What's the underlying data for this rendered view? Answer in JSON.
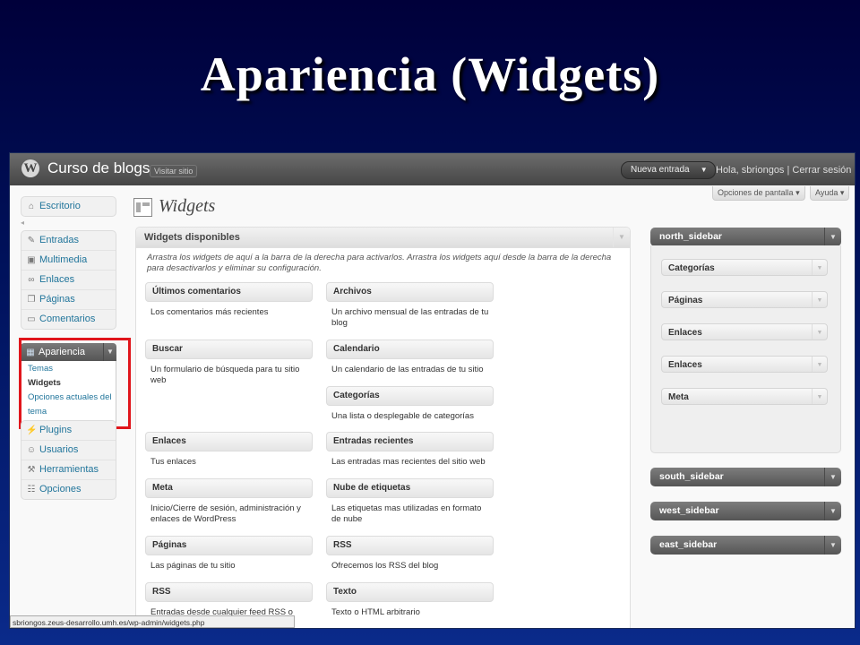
{
  "slide": {
    "title": "Apariencia (Widgets)"
  },
  "admin_bar": {
    "site_name": "Curso de blogs",
    "visit_site": "Visitar sitio",
    "new_entry": "Nueva entrada",
    "greeting": "Hola, sbriongos | Cerrar sesión"
  },
  "screen_options": {
    "options_label": "Opciones de pantalla",
    "help_label": "Ayuda"
  },
  "menu": {
    "dashboard": {
      "label": "Escritorio",
      "icon": "home-icon"
    },
    "group1": [
      {
        "label": "Entradas",
        "icon": "pin-icon"
      },
      {
        "label": "Multimedia",
        "icon": "media-icon"
      },
      {
        "label": "Enlaces",
        "icon": "link-icon"
      },
      {
        "label": "Páginas",
        "icon": "pages-icon"
      },
      {
        "label": "Comentarios",
        "icon": "comments-icon"
      }
    ],
    "appearance": {
      "label": "Apariencia",
      "submenu": [
        {
          "label": "Temas"
        },
        {
          "label": "Widgets"
        },
        {
          "label": "Opciones actuales del tema"
        }
      ]
    },
    "group2": [
      {
        "label": "Plugins",
        "icon": "plugin-icon"
      },
      {
        "label": "Usuarios",
        "icon": "users-icon"
      },
      {
        "label": "Herramientas",
        "icon": "tools-icon"
      },
      {
        "label": "Opciones",
        "icon": "settings-icon"
      }
    ]
  },
  "page": {
    "title": "Widgets"
  },
  "available": {
    "header": "Widgets disponibles",
    "description": "Arrastra los widgets de aquí a la barra de la derecha para activarlos. Arrastra los widgets aquí desde la barra de la derecha para desactivarlos y eliminar su configuración.",
    "widgets": [
      {
        "title": "Últimos comentarios",
        "desc": "Los comentarios más recientes"
      },
      {
        "title": "Archivos",
        "desc": "Un archivo mensual de las entradas de tu blog"
      },
      {
        "title": "Buscar",
        "desc": "Un formulario de búsqueda para tu sitio web"
      },
      {
        "title": "Calendario",
        "desc": "Un calendario de las entradas de tu sitio"
      },
      {
        "title": "Categorías",
        "desc": "Una lista o desplegable de categorías"
      },
      {
        "title": "Enlaces",
        "desc": "Tus enlaces"
      },
      {
        "title": "Entradas recientes",
        "desc": "Las entradas mas recientes del sitio web"
      },
      {
        "title": "Meta",
        "desc": "Inicio/Cierre de sesión, administración y enlaces de WordPress"
      },
      {
        "title": "Nube de etiquetas",
        "desc": "Las etiquetas mas utilizadas en formato de nube"
      },
      {
        "title": "Páginas",
        "desc": "Las páginas de tu sitio"
      },
      {
        "title": "RSS",
        "desc": "Ofrecemos los RSS del blog"
      },
      {
        "title": "RSS",
        "desc": "Entradas desde cualquier feed RSS o"
      },
      {
        "title": "Texto",
        "desc": "Texto o HTML arbitrario"
      }
    ]
  },
  "sidebars": {
    "north": {
      "name": "north_sidebar",
      "widgets": [
        "Categorías",
        "Páginas",
        "Enlaces",
        "Enlaces",
        "Meta"
      ]
    },
    "south": {
      "name": "south_sidebar"
    },
    "west": {
      "name": "west_sidebar"
    },
    "east": {
      "name": "east_sidebar"
    }
  },
  "statusbar": {
    "url": "sbriongos.zeus-desarrollo.umh.es/wp-admin/widgets.php"
  },
  "colors": {
    "highlight_box": "#e0151b",
    "link": "#21759b",
    "slide_bg": "#00115a"
  }
}
